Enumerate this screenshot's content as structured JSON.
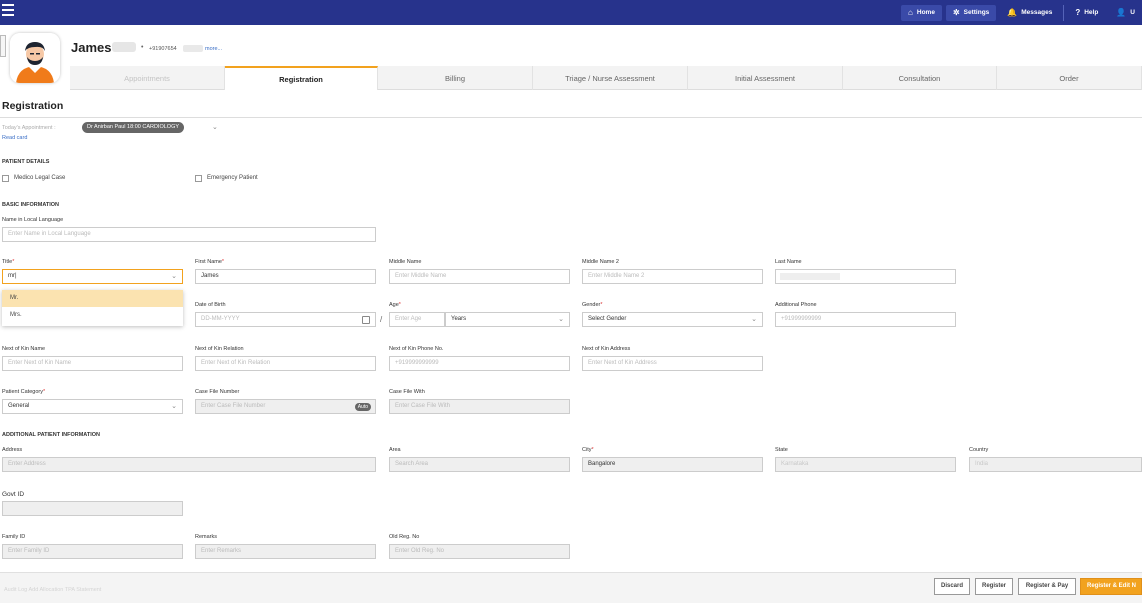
{
  "topbar": {
    "nav": [
      {
        "name": "home",
        "icon": "home-icon",
        "glyph": "⌂",
        "label": "Home",
        "boxed": true
      },
      {
        "name": "settings",
        "icon": "gear-icon",
        "glyph": "✲",
        "label": "Settings",
        "boxed": true
      },
      {
        "name": "messages",
        "icon": "bell-icon",
        "glyph": "🔔",
        "label": "Messages",
        "boxed": false
      },
      {
        "name": "help",
        "icon": "question-icon",
        "glyph": "?",
        "label": "Help",
        "boxed": false
      },
      {
        "name": "user",
        "icon": "user-icon",
        "glyph": "👤",
        "label": "U",
        "boxed": false
      }
    ]
  },
  "patient": {
    "name": "James",
    "separator": "•",
    "phone": "+91907654",
    "more": "more..."
  },
  "tabs": [
    {
      "label": "Appointments",
      "state": "faded"
    },
    {
      "label": "Registration",
      "state": "active"
    },
    {
      "label": "Billing",
      "state": ""
    },
    {
      "label": "Triage / Nurse Assessment",
      "state": ""
    },
    {
      "label": "Initial Assessment",
      "state": ""
    },
    {
      "label": "Consultation",
      "state": ""
    },
    {
      "label": "Order",
      "state": ""
    }
  ],
  "page": {
    "title": "Registration",
    "appointment_label": "Today's Appointment :",
    "appointment_chip": "Dr Anirban Paul 18:00 CARDIOLOGY",
    "read_card": "Read card"
  },
  "patient_details": {
    "heading": "PATIENT DETAILS",
    "medico_legal": "Medico Legal Case",
    "emergency": "Emergency Patient"
  },
  "basic": {
    "heading": "BASIC INFORMATION",
    "local_name_label": "Name in Local Language",
    "local_name_placeholder": "Enter Name in Local Language",
    "title_label": "Title",
    "title_value": "mr|",
    "first_label": "First Name",
    "first_value": "James",
    "middle_label": "Middle Name",
    "middle_placeholder": "Enter Middle Name",
    "middle2_label": "Middle Name 2",
    "middle2_placeholder": "Enter Middle Name 2",
    "last_label": "Last Name",
    "dob_label": "Date of Birth",
    "dob_placeholder": "DD-MM-YYYY",
    "age_label": "Age",
    "age_placeholder": "Enter Age",
    "age_separator": "/",
    "age_unit": "Years",
    "gender_label": "Gender",
    "gender_value": "Select Gender",
    "addl_phone_label": "Additional Phone",
    "addl_phone_placeholder": "+91999999999",
    "kin_name_label": "Next of Kin Name",
    "kin_name_placeholder": "Enter Next of Kin Name",
    "kin_rel_label": "Next of Kin Relation",
    "kin_rel_placeholder": "Enter Next of Kin Relation",
    "kin_phone_label": "Next of Kin Phone No.",
    "kin_phone_placeholder": "+919999999999",
    "kin_addr_label": "Next of Kin Address",
    "kin_addr_placeholder": "Enter Next of Kin Address",
    "category_label": "Patient Category",
    "category_value": "General",
    "case_no_label": "Case File Number",
    "case_no_placeholder": "Enter Case File Number",
    "case_auto": "Auto",
    "case_with_label": "Case File With",
    "case_with_placeholder": "Enter Case File With"
  },
  "title_dropdown": {
    "options": [
      "Mr.",
      "Mrs."
    ]
  },
  "additional": {
    "heading": "ADDITIONAL PATIENT INFORMATION",
    "address_label": "Address",
    "address_placeholder": "Enter Address",
    "area_label": "Area",
    "area_placeholder": "Search Area",
    "city_label": "City",
    "city_value": "Bangalore",
    "state_label": "State",
    "state_value": "Karnataka",
    "country_label": "Country",
    "country_value": "India",
    "govt_label": "Govt ID",
    "family_label": "Family ID",
    "family_placeholder": "Enter Family ID",
    "remarks_label": "Remarks",
    "remarks_placeholder": "Enter Remarks",
    "oldreg_label": "Old Reg. No",
    "oldreg_placeholder": "Enter Old Reg. No"
  },
  "footer": {
    "links": "Audit Log   Add Allocation   TPA Statement",
    "discard": "Discard",
    "register": "Register",
    "register_pay": "Register & Pay",
    "register_edit": "Register & Edit N"
  }
}
